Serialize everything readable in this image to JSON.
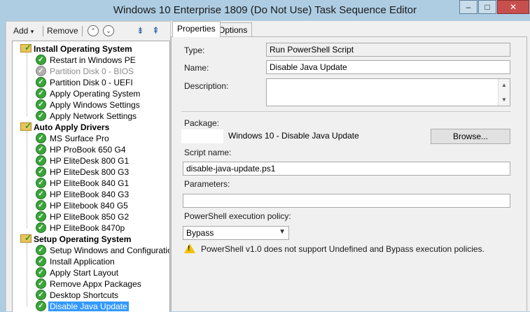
{
  "window": {
    "title": "Windows 10 Enterprise 1809 (Do Not Use) Task Sequence Editor",
    "minimize": "–",
    "maximize": "□",
    "close": "✕"
  },
  "toolbar": {
    "add_label": "Add",
    "add_arrow": "▾",
    "remove_label": "Remove",
    "move_up": "⌃",
    "move_down": "⌄"
  },
  "tree": {
    "groups": [
      {
        "label": "Install Operating System",
        "steps": [
          {
            "label": "Restart in Windows PE",
            "disabled": false
          },
          {
            "label": "Partition Disk 0 - BIOS",
            "disabled": true
          },
          {
            "label": "Partition Disk 0 - UEFI",
            "disabled": false
          },
          {
            "label": "Apply Operating System",
            "disabled": false
          },
          {
            "label": "Apply Windows Settings",
            "disabled": false
          },
          {
            "label": "Apply Network Settings",
            "disabled": false
          }
        ]
      },
      {
        "label": "Auto Apply Drivers",
        "steps": [
          {
            "label": "MS Surface Pro",
            "disabled": false
          },
          {
            "label": "HP ProBook 650 G4",
            "disabled": false
          },
          {
            "label": "HP EliteDesk 800 G1",
            "disabled": false
          },
          {
            "label": "HP EliteDesk 800 G3",
            "disabled": false
          },
          {
            "label": "HP EliteBook 840 G1",
            "disabled": false
          },
          {
            "label": "HP EliteBook 840 G3",
            "disabled": false
          },
          {
            "label": "HP Elitebook 840 G5",
            "disabled": false
          },
          {
            "label": "HP EliteBook 850 G2",
            "disabled": false
          },
          {
            "label": "HP EliteBook 8470p",
            "disabled": false
          }
        ]
      },
      {
        "label": "Setup Operating System",
        "steps": [
          {
            "label": "Setup Windows and Configuration",
            "disabled": false
          },
          {
            "label": "Install Application",
            "disabled": false
          },
          {
            "label": "Apply Start Layout",
            "disabled": false
          },
          {
            "label": "Remove Appx Packages",
            "disabled": false
          },
          {
            "label": "Desktop Shortcuts",
            "disabled": false
          },
          {
            "label": "Disable Java Update",
            "disabled": false,
            "selected": true
          }
        ]
      }
    ]
  },
  "tabs": [
    {
      "label": "Properties",
      "active": true
    },
    {
      "label": "Options",
      "active": false
    }
  ],
  "properties": {
    "type_label": "Type:",
    "type_value": "Run PowerShell Script",
    "name_label": "Name:",
    "name_value": "Disable Java Update",
    "description_label": "Description:",
    "description_value": "",
    "package_label": "Package:",
    "package_value": "Windows 10 - Disable Java Update",
    "browse_label": "Browse...",
    "script_name_label": "Script name:",
    "script_name_value": "disable-java-update.ps1",
    "parameters_label": "Parameters:",
    "parameters_value": "",
    "policy_label": "PowerShell execution policy:",
    "policy_value": "Bypass",
    "warning_text": "PowerShell v1.0 does not support Undefined and Bypass execution policies."
  },
  "colors": {
    "titlebar": "#aecde3",
    "selection": "#3399ff",
    "success_check": "#3aa63a",
    "warning": "#f2c200"
  }
}
